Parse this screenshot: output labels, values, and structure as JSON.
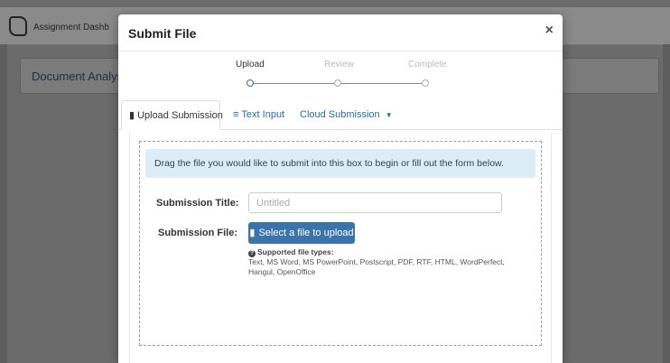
{
  "app": {
    "header_title": "Assignment Dashb",
    "panel_title": "Document Analys"
  },
  "modal": {
    "title": "Submit File",
    "close_icon": "×",
    "steps": [
      {
        "label": "Upload",
        "state": "active"
      },
      {
        "label": "Review",
        "state": "inactive"
      },
      {
        "label": "Complete",
        "state": "inactive"
      }
    ],
    "tabs": {
      "upload_submission": "Upload Submission",
      "text_input": "Text Input",
      "cloud_submission": "Cloud Submission"
    },
    "dropzone": {
      "instruction": "Drag the file you would like to submit into this box to begin or fill out the form below."
    },
    "form": {
      "title_label": "Submission Title:",
      "title_placeholder": "Untitled",
      "file_label": "Submission File:",
      "upload_button": "Select a file to upload",
      "supported_title": "Supported file types:",
      "supported_list": "Text, MS Word, MS PowerPoint, Postscript, PDF, RTF, HTML, WordPerfect, Hangul, OpenOffice"
    }
  },
  "colors": {
    "accent": "#3a74ab",
    "link": "#2d6aa0",
    "info_bg": "#dcedf7"
  }
}
